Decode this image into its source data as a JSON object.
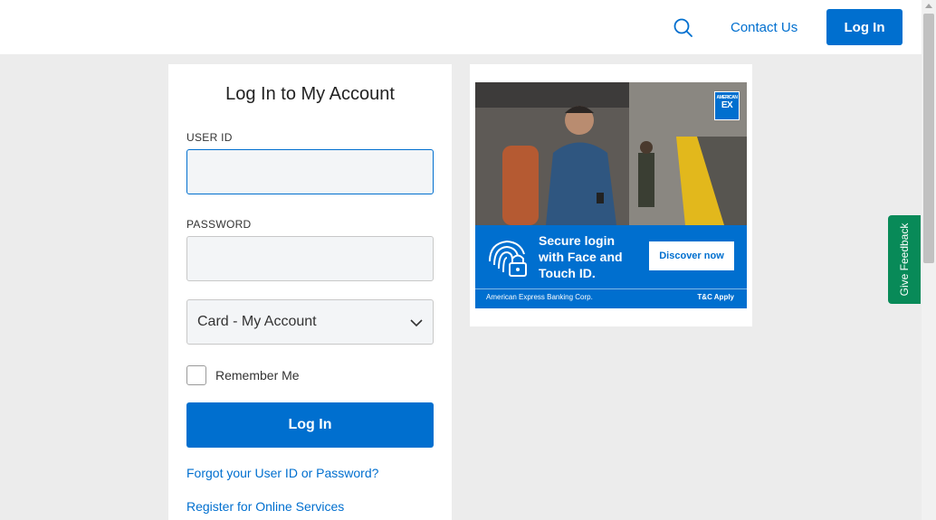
{
  "header": {
    "search_icon": "magnifier-icon",
    "contact_label": "Contact Us",
    "login_label": "Log In"
  },
  "login_form": {
    "title": "Log In to My Account",
    "user_id_label": "USER ID",
    "user_id_value": "",
    "password_label": "PASSWORD",
    "password_value": "",
    "account_type_selected": "Card - My Account",
    "remember_label": "Remember Me",
    "remember_checked": false,
    "submit_label": "Log In",
    "forgot_link": "Forgot your User ID or Password?",
    "register_link": "Register for Online Services"
  },
  "ad": {
    "logo_line1": "AMERICAN",
    "logo_line2": "EX",
    "headline": "Secure login with Face and Touch ID.",
    "cta": "Discover now",
    "fine_print": "American Express Banking Corp.",
    "terms": "T&C Apply",
    "brand_color": "#006fcf"
  },
  "feedback": {
    "label": "Give Feedback",
    "color": "#088a58"
  },
  "colors": {
    "accent": "#006fcf",
    "background": "#ececec"
  }
}
